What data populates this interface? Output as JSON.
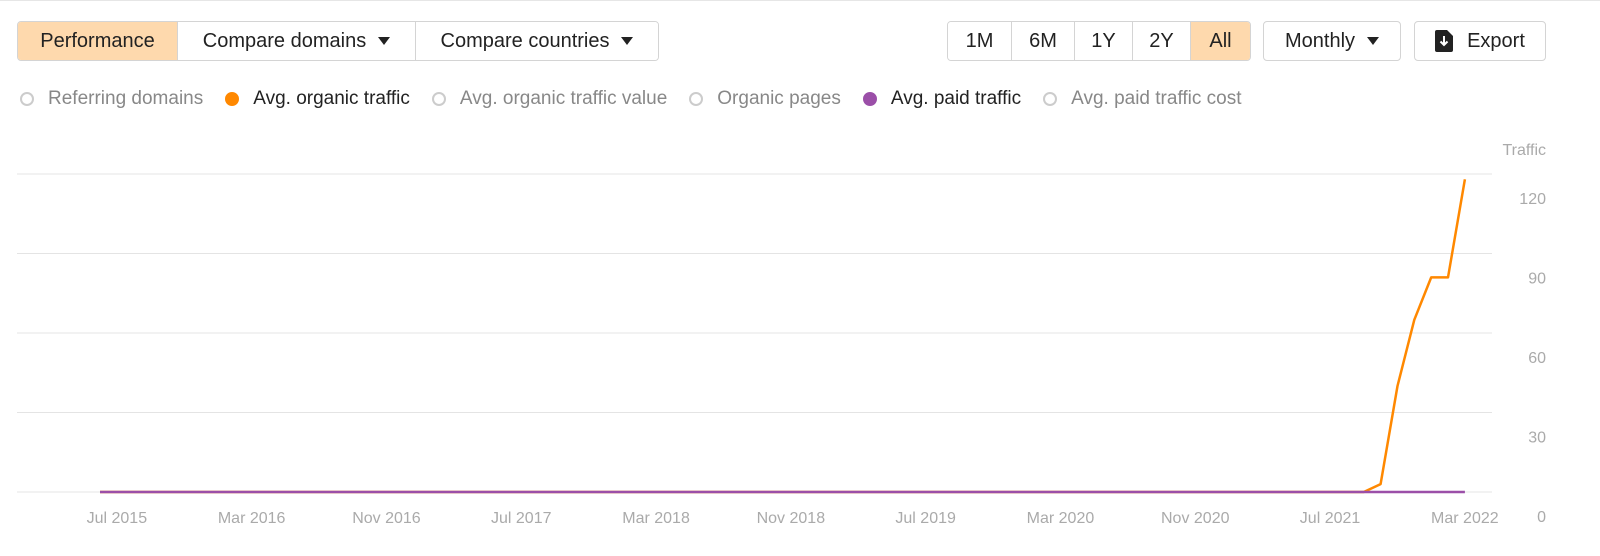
{
  "toolbar": {
    "tabs": [
      {
        "label": "Performance",
        "active": true
      },
      {
        "label": "Compare domains",
        "dropdown": true
      },
      {
        "label": "Compare countries",
        "dropdown": true
      }
    ],
    "ranges": [
      {
        "label": "1M"
      },
      {
        "label": "6M"
      },
      {
        "label": "1Y"
      },
      {
        "label": "2Y"
      },
      {
        "label": "All",
        "active": true
      }
    ],
    "interval": "Monthly",
    "export": "Export"
  },
  "legend": [
    {
      "label": "Referring domains",
      "active": false,
      "color": "#cccccc"
    },
    {
      "label": "Avg. organic traffic",
      "active": true,
      "color": "#ff8800"
    },
    {
      "label": "Avg. organic traffic value",
      "active": false,
      "color": "#cccccc"
    },
    {
      "label": "Organic pages",
      "active": false,
      "color": "#cccccc"
    },
    {
      "label": "Avg. paid traffic",
      "active": true,
      "color": "#9b4fa8"
    },
    {
      "label": "Avg. paid traffic cost",
      "active": false,
      "color": "#cccccc"
    }
  ],
  "chart_data": {
    "type": "line",
    "ylabel": "Traffic",
    "ylim": [
      0,
      120
    ],
    "yticks": [
      0,
      30,
      60,
      90,
      120
    ],
    "x_start": "Jun 2015",
    "x_end": "Mar 2022",
    "xticks": [
      "Jul 2015",
      "Mar 2016",
      "Nov 2016",
      "Jul 2017",
      "Mar 2018",
      "Nov 2018",
      "Jul 2019",
      "Mar 2020",
      "Nov 2020",
      "Jul 2021",
      "Mar 2022"
    ],
    "xtick_month_index": [
      1,
      9,
      17,
      25,
      33,
      41,
      49,
      57,
      65,
      73,
      81
    ],
    "grid": true,
    "series": [
      {
        "name": "Avg. organic traffic",
        "color": "#ff8800",
        "values": [
          0,
          0,
          0,
          0,
          0,
          0,
          0,
          0,
          0,
          0,
          0,
          0,
          0,
          0,
          0,
          0,
          0,
          0,
          0,
          0,
          0,
          0,
          0,
          0,
          0,
          0,
          0,
          0,
          0,
          0,
          0,
          0,
          0,
          0,
          0,
          0,
          0,
          0,
          0,
          0,
          0,
          0,
          0,
          0,
          0,
          0,
          0,
          0,
          0,
          0,
          0,
          0,
          0,
          0,
          0,
          0,
          0,
          0,
          0,
          0,
          0,
          0,
          0,
          0,
          0,
          0,
          0,
          0,
          0,
          0,
          0,
          0,
          0,
          0,
          0,
          0,
          3,
          40,
          65,
          81,
          81,
          118
        ]
      },
      {
        "name": "Avg. paid traffic",
        "color": "#9b4fa8",
        "values": [
          0,
          0,
          0,
          0,
          0,
          0,
          0,
          0,
          0,
          0,
          0,
          0,
          0,
          0,
          0,
          0,
          0,
          0,
          0,
          0,
          0,
          0,
          0,
          0,
          0,
          0,
          0,
          0,
          0,
          0,
          0,
          0,
          0,
          0,
          0,
          0,
          0,
          0,
          0,
          0,
          0,
          0,
          0,
          0,
          0,
          0,
          0,
          0,
          0,
          0,
          0,
          0,
          0,
          0,
          0,
          0,
          0,
          0,
          0,
          0,
          0,
          0,
          0,
          0,
          0,
          0,
          0,
          0,
          0,
          0,
          0,
          0,
          0,
          0,
          0,
          0,
          0,
          0,
          0,
          0,
          0,
          0
        ]
      }
    ]
  }
}
